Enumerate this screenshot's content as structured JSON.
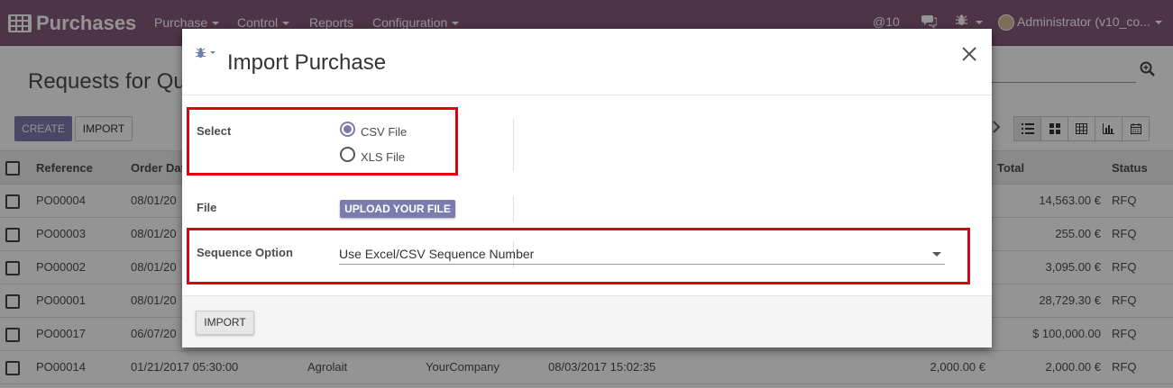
{
  "navbar": {
    "app_title": "Purchases",
    "menus": [
      "Purchase",
      "Control",
      "Reports",
      "Configuration"
    ],
    "notifications": "@10",
    "user": "Administrator (v10_co..."
  },
  "background": {
    "page_title": "Requests for Qu",
    "create_label": "CREATE",
    "import_label": "IMPORT",
    "columns": [
      "Reference",
      "Order Dat",
      "Total",
      "Status"
    ],
    "rows": [
      {
        "ref": "PO00004",
        "date": "08/01/20",
        "total": "14,563.00 €",
        "status": "RFQ"
      },
      {
        "ref": "PO00003",
        "date": "08/01/20",
        "total": "255.00 €",
        "status": "RFQ"
      },
      {
        "ref": "PO00002",
        "date": "08/01/20",
        "total": "3,095.00 €",
        "status": "RFQ"
      },
      {
        "ref": "PO00001",
        "date": "08/01/20",
        "total": "28,729.30 €",
        "status": "RFQ"
      },
      {
        "ref": "PO00017",
        "date": "06/07/20",
        "total": "$ 100,000.00",
        "status": "RFQ"
      },
      {
        "ref": "PO00014",
        "date": "01/21/2017 05:30:00",
        "vendor": "Agrolait",
        "company": "YourCompany",
        "scheduled": "08/03/2017 15:02:35",
        "untaxed": "2,000.00 €",
        "total": "2,000.00 €",
        "status": "RFQ"
      }
    ]
  },
  "dialog": {
    "title": "Import Purchase",
    "select_label": "Select",
    "options": [
      "CSV File",
      "XLS File"
    ],
    "selected_option": "CSV File",
    "file_label": "File",
    "upload_label": "UPLOAD YOUR FILE",
    "sequence_label": "Sequence Option",
    "sequence_value": "Use Excel/CSV Sequence Number",
    "import_button": "IMPORT"
  },
  "colors": {
    "brand": "#875a7b",
    "primary_button": "#7c7bad",
    "highlight": "#e00012"
  }
}
